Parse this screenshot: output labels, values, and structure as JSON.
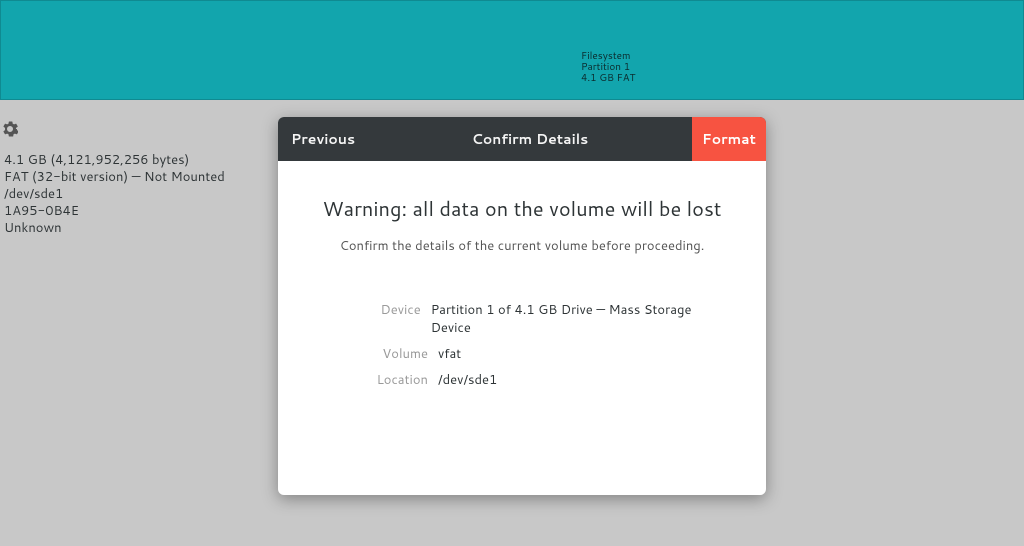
{
  "partition_strip": {
    "line1": "Filesystem",
    "line2": "Partition 1",
    "line3": "4.1 GB FAT"
  },
  "volume_details": {
    "size": "4.1 GB (4,121,952,256 bytes)",
    "fs": "FAT (32-bit version) — Not Mounted",
    "device": "/dev/sde1",
    "uuid": "1A95-0B4E",
    "extra": "Unknown"
  },
  "dialog": {
    "previous_label": "Previous",
    "title": "Confirm Details",
    "format_label": "Format",
    "warning_title": "Warning: all data on the volume will be lost",
    "warning_sub": "Confirm the details of the current volume before proceeding.",
    "labels": {
      "device": "Device",
      "volume": "Volume",
      "location": "Location"
    },
    "values": {
      "device": "Partition 1 of 4.1 GB Drive — Mass Storage Device",
      "volume": "vfat",
      "location": "/dev/sde1"
    }
  }
}
